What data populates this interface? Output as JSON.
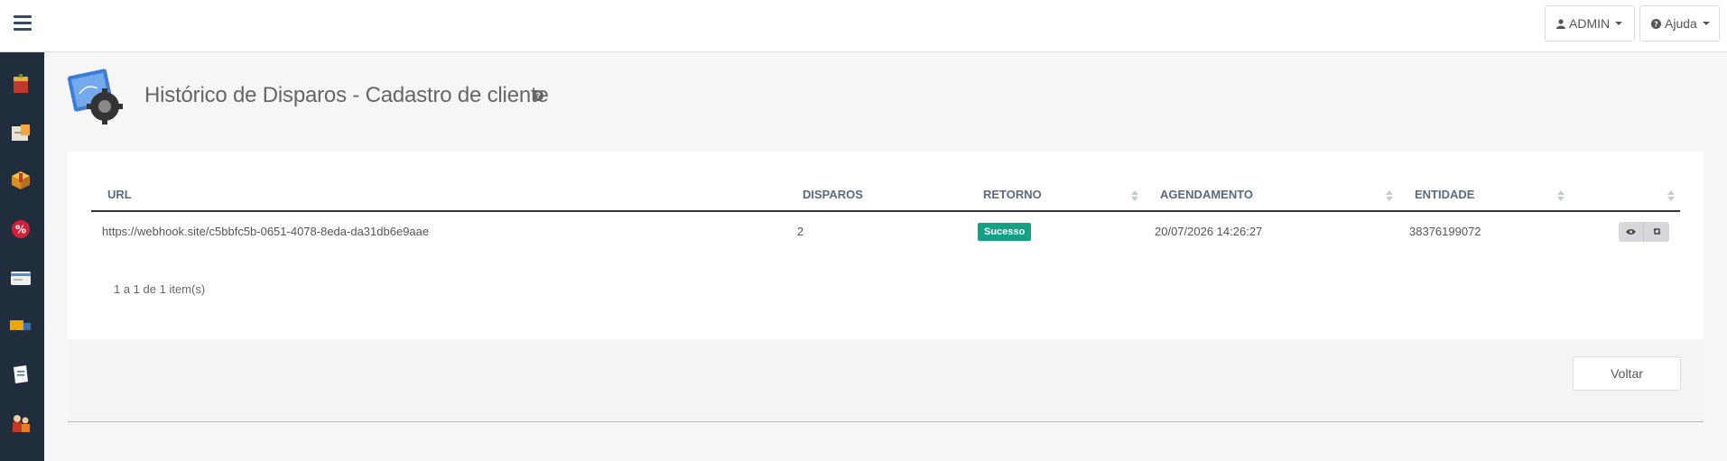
{
  "topbar": {
    "menu_icon": "hamburger-icon",
    "user_button_label": "ADMIN",
    "help_button_label": "Ajuda"
  },
  "sidebar": {
    "items": [
      {
        "icon": "box-icon"
      },
      {
        "icon": "document-icon"
      },
      {
        "icon": "package-icon"
      },
      {
        "icon": "percent-icon"
      },
      {
        "icon": "card-icon"
      },
      {
        "icon": "truck-icon"
      },
      {
        "icon": "note-icon"
      },
      {
        "icon": "users-icon"
      }
    ]
  },
  "page": {
    "title": "Histórico de Disparos - Cadastro de cliente"
  },
  "table": {
    "columns": [
      "URL",
      "DISPAROS",
      "RETORNO",
      "AGENDAMENTO",
      "ENTIDADE",
      ""
    ],
    "rows": [
      {
        "url": "https://webhook.site/c5bbfc5b-0651-4078-8eda-da31db6e9aae",
        "disparos": "2",
        "retorno": "Sucesso",
        "agendamento": "20/07/2026 14:26:27",
        "entidade": "38376199072"
      }
    ]
  },
  "pager": {
    "info": "1 a 1 de 1 item(s)"
  },
  "footer": {
    "back_label": "Voltar"
  },
  "colors": {
    "sidebar_bg": "#1f2d3d",
    "success": "#14a085"
  }
}
